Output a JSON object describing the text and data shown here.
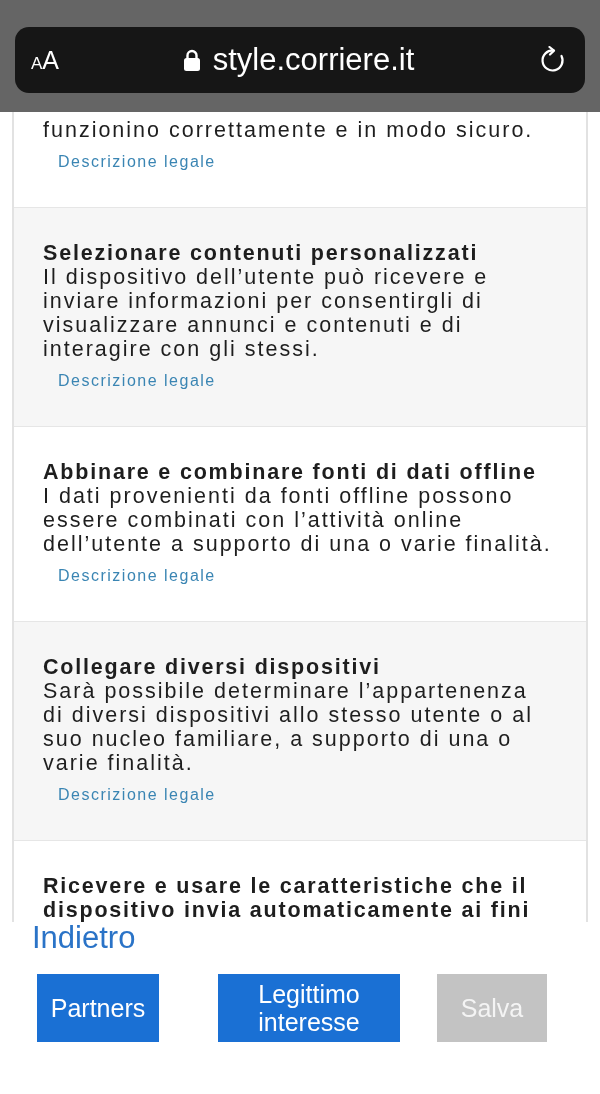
{
  "browser": {
    "text_size": {
      "small": "A",
      "large": "A"
    },
    "secure": true,
    "url": "style.corriere.it"
  },
  "purposes": [
    {
      "description": "funzionino correttamente e in modo sicuro.",
      "link": "Descrizione legale"
    },
    {
      "title": "Selezionare contenuti personalizzati",
      "description": "Il dispositivo dell’utente può ricevere e inviare informazioni per consentirgli di visualizzare annunci e contenuti e di interagire con gli stessi.",
      "link": "Descrizione legale"
    },
    {
      "title": "Abbinare e combinare fonti di dati offline",
      "description": "I dati provenienti da fonti offline possono essere combinati con l’attività online dell’utente a supporto di una o varie finalità.",
      "link": "Descrizione legale"
    },
    {
      "title": "Collegare diversi dispositivi",
      "description": "Sarà possibile determinare l’appartenenza di diversi dispositivi allo stesso utente o al suo nucleo familiare, a supporto di una o varie finalità.",
      "link": "Descrizione legale"
    },
    {
      "title": "Ricevere e usare le caratteristiche che il dispositivo invia automaticamente ai fini"
    }
  ],
  "footer": {
    "back_link": "Indietro",
    "buttons": [
      {
        "label": "Partners",
        "disabled": false
      },
      {
        "label": "Legittimo interesse",
        "disabled": false
      },
      {
        "label": "Salva",
        "disabled": true
      }
    ]
  }
}
